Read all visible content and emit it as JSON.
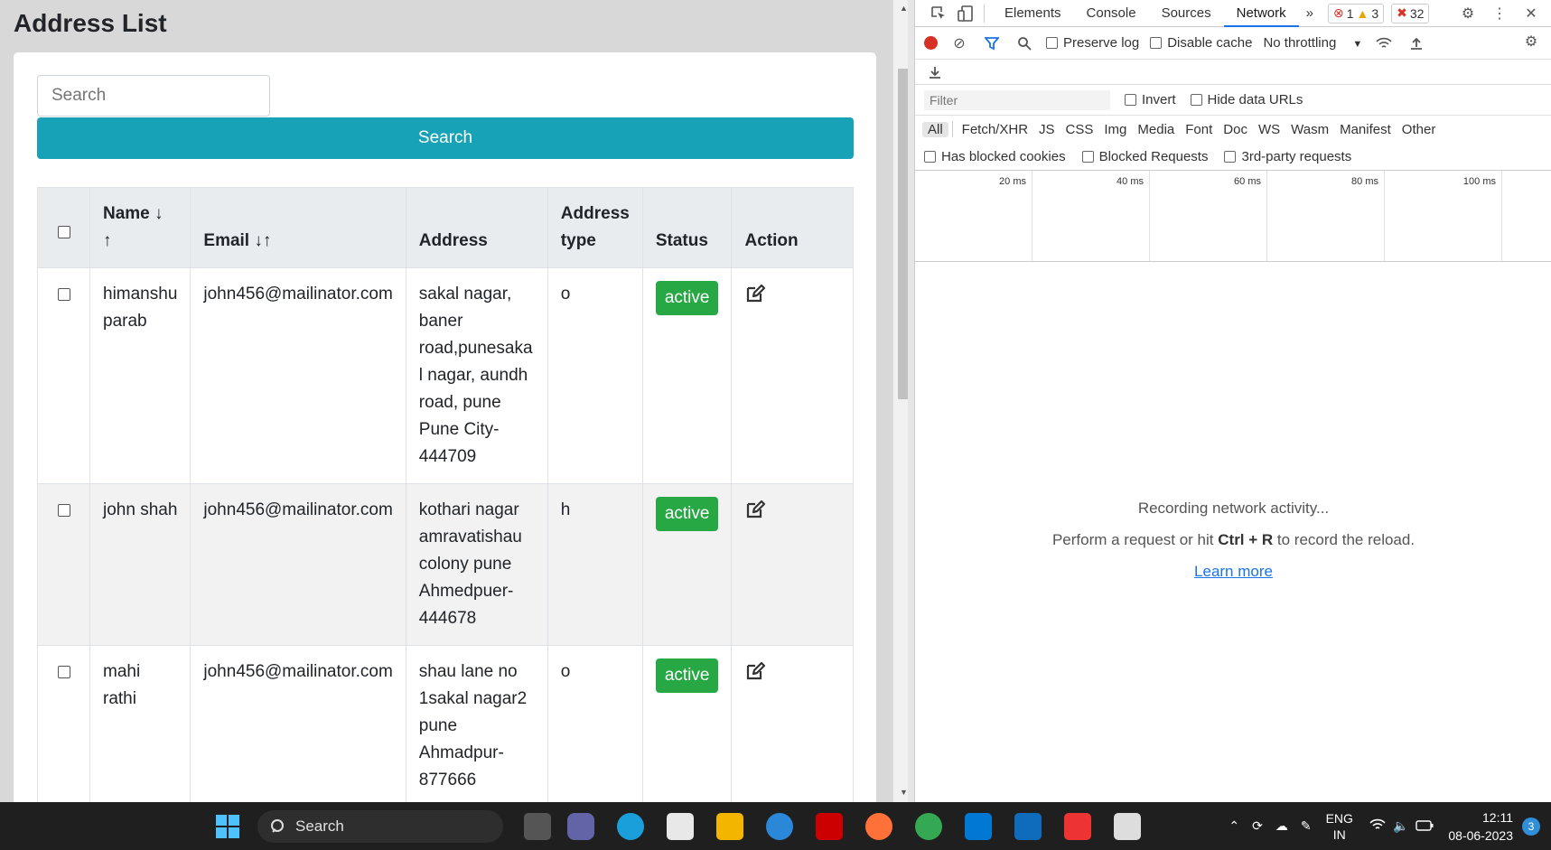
{
  "page": {
    "title": "Address List",
    "search_placeholder": "Search",
    "search_button": "Search"
  },
  "table": {
    "headers": {
      "name": "Name",
      "email": "Email",
      "address": "Address",
      "address_type_line1": "Address",
      "address_type_line2": "type",
      "status": "Status",
      "action": "Action"
    },
    "sort_icons": {
      "name_down": "↓",
      "name_up": "↑",
      "email": "↓↑"
    },
    "rows": [
      {
        "name": "himanshu parab",
        "email": "john456@mailinator.com",
        "address": "sakal nagar, baner road,punesakal nagar, aundh road, pune Pune City-444709",
        "type": "o",
        "status": "active"
      },
      {
        "name": "john shah",
        "email": "john456@mailinator.com",
        "address": "kothari nagar amravatishau colony pune Ahmedpuer-444678",
        "type": "h",
        "status": "active"
      },
      {
        "name": "mahi rathi",
        "email": "john456@mailinator.com",
        "address": "shau lane no 1sakal nagar2 pune Ahmadpur-877666",
        "type": "o",
        "status": "active"
      }
    ],
    "status_color": "#28a745"
  },
  "devtools": {
    "tabs": [
      "Elements",
      "Console",
      "Sources",
      "Network"
    ],
    "active_tab": "Network",
    "more_tabs": "»",
    "errors": "1",
    "warnings": "3",
    "issues": "32",
    "preserve_log": "Preserve log",
    "disable_cache": "Disable cache",
    "throttling": "No throttling",
    "filter_placeholder": "Filter",
    "invert": "Invert",
    "hide_data_urls": "Hide data URLs",
    "types": [
      "All",
      "Fetch/XHR",
      "JS",
      "CSS",
      "Img",
      "Media",
      "Font",
      "Doc",
      "WS",
      "Wasm",
      "Manifest",
      "Other"
    ],
    "has_blocked_cookies": "Has blocked cookies",
    "blocked_requests": "Blocked Requests",
    "third_party": "3rd-party requests",
    "timeline_ticks": [
      "20 ms",
      "40 ms",
      "60 ms",
      "80 ms",
      "100 ms"
    ],
    "empty_line1": "Recording network activity...",
    "empty_line2_pre": "Perform a request or hit ",
    "empty_line2_key": "Ctrl + R",
    "empty_line2_post": " to record the reload.",
    "learn_more": "Learn more",
    "accent_color": "#1a73e8"
  },
  "taskbar": {
    "search_label": "Search",
    "language_line1": "ENG",
    "language_line2": "IN",
    "time": "12:11",
    "date": "08-06-2023",
    "notification_count": "3"
  }
}
